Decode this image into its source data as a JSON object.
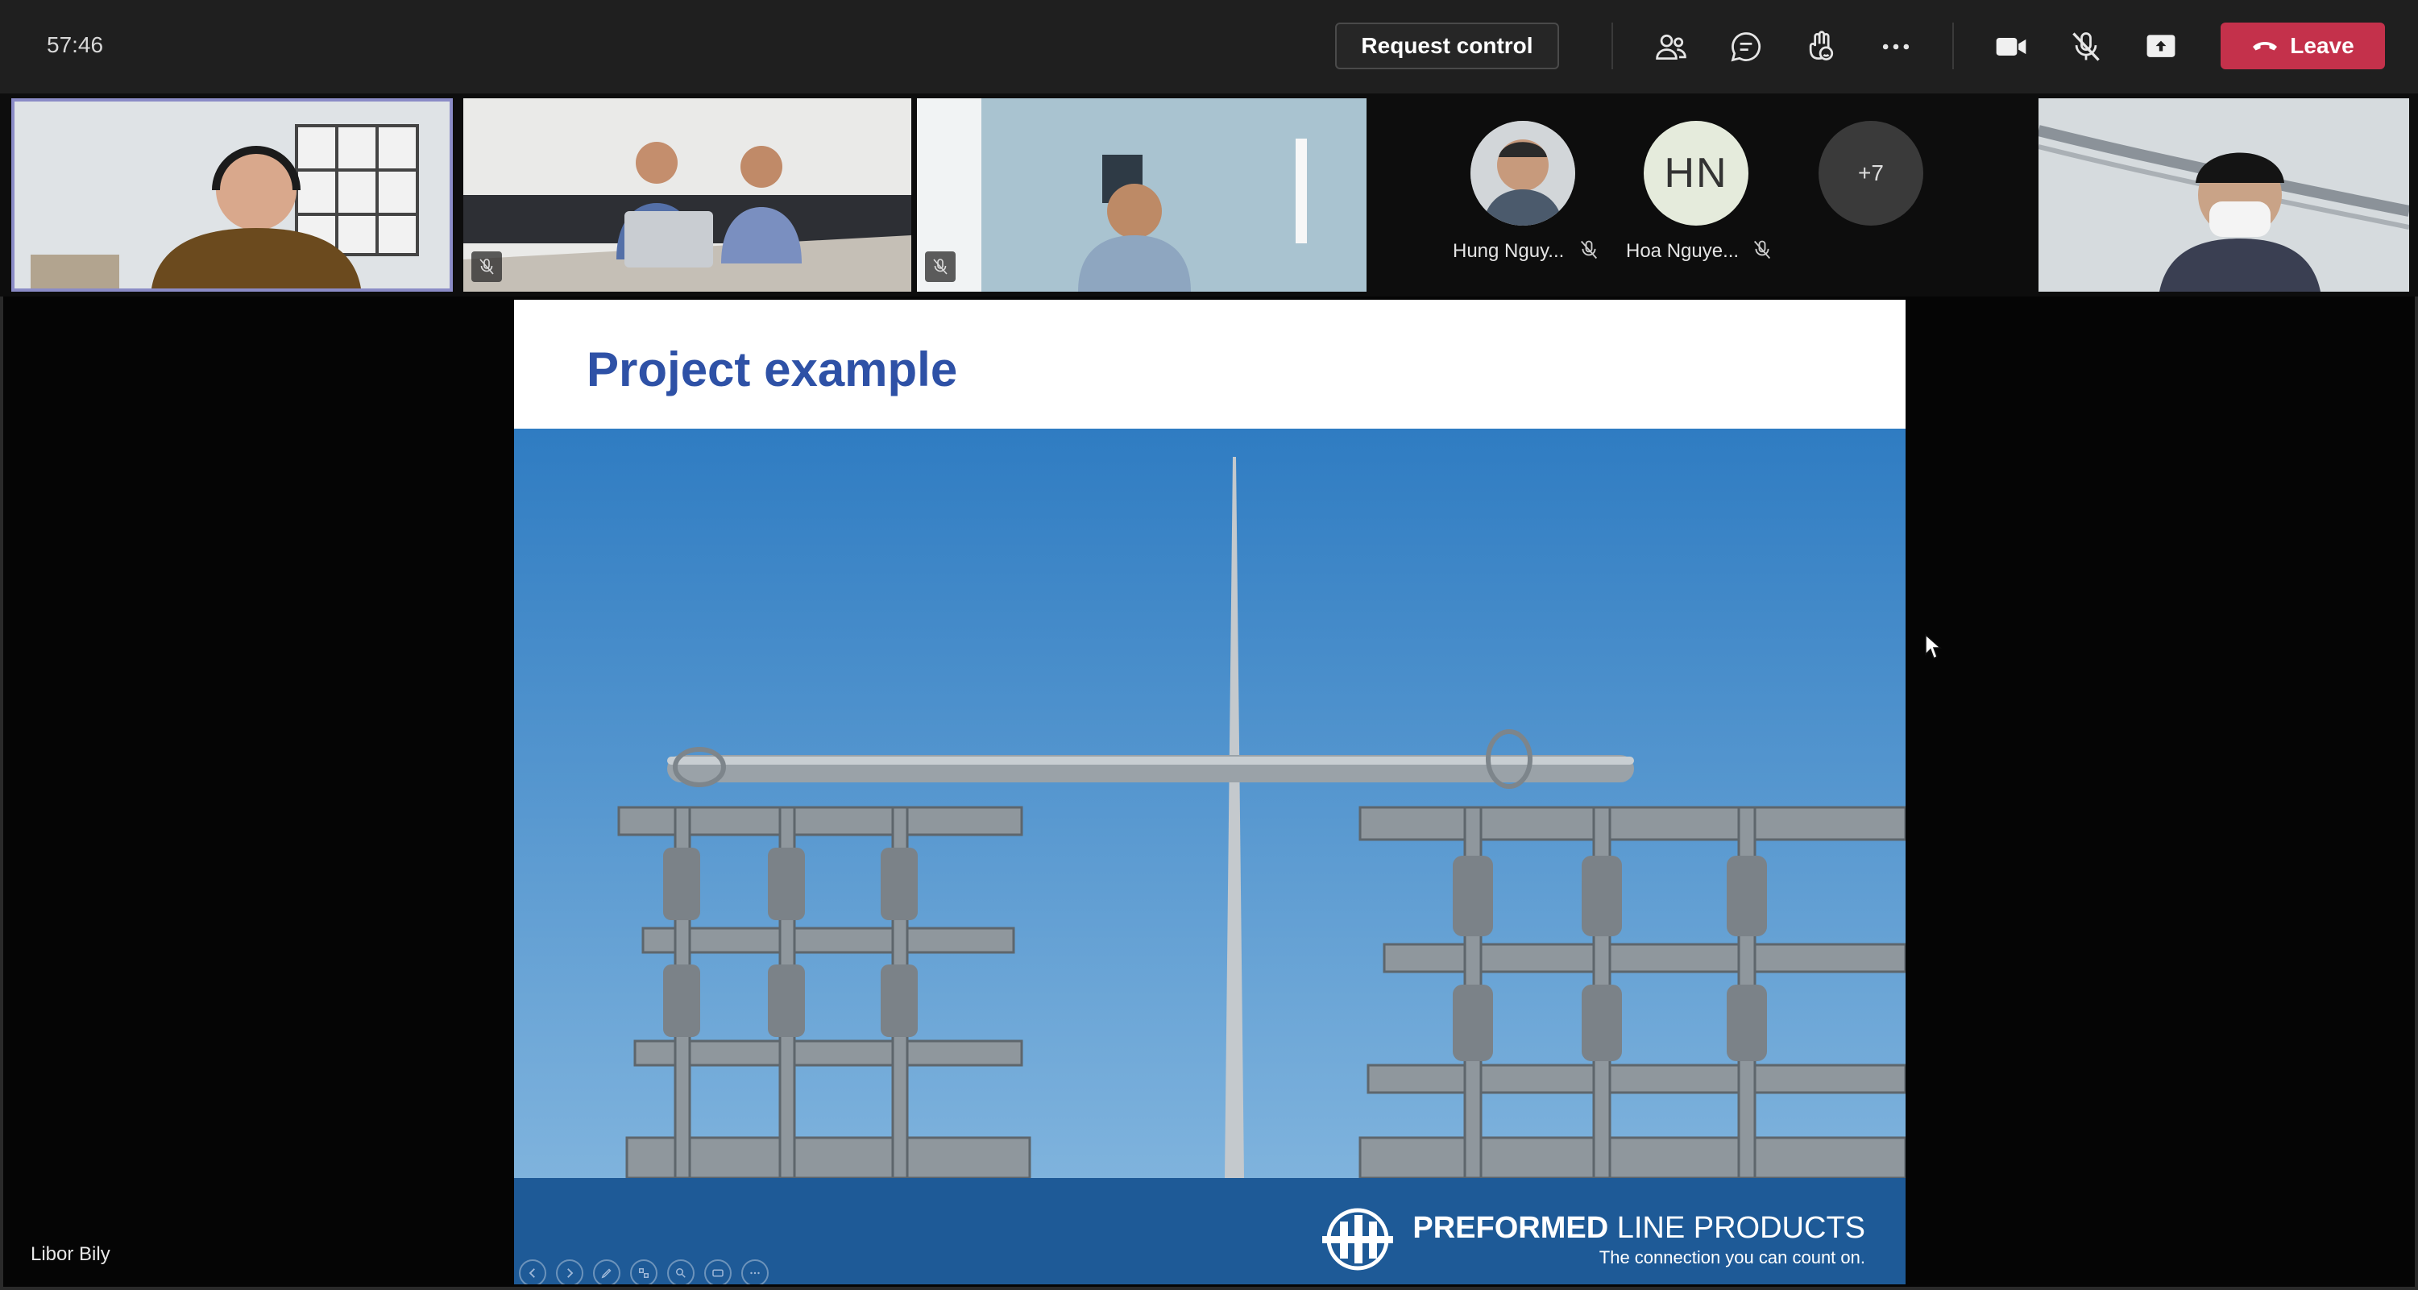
{
  "meeting": {
    "timer": "57:46",
    "request_control_label": "Request control",
    "leave_label": "Leave",
    "accent_leave": "#c4314b",
    "icons": [
      "participants-icon",
      "chat-icon",
      "reactions-icon",
      "more-options-icon",
      "camera-icon",
      "mic-off-icon",
      "share-icon",
      "hang-up-icon"
    ]
  },
  "participants": {
    "tiles": [
      {
        "id": "video-1",
        "active_speaker": true,
        "muted": false
      },
      {
        "id": "video-2",
        "muted": true
      },
      {
        "id": "video-3",
        "muted": true
      },
      {
        "id": "video-5",
        "muted": false
      }
    ],
    "avatars": [
      {
        "name": "Hung Nguy...",
        "muted": true
      },
      {
        "name": "Hoa Nguye...",
        "initials": "HN",
        "muted": true
      },
      {
        "more": "+7"
      }
    ]
  },
  "slide": {
    "title": "Project example",
    "brand_name_bold": "PREFORMED",
    "brand_name_rest": " LINE PRODUCTS",
    "brand_tagline": "The connection you can count on.",
    "title_color": "#2e51a6",
    "footer_color": "#1e5a97"
  },
  "presenter": {
    "name": "Libor Bily"
  }
}
